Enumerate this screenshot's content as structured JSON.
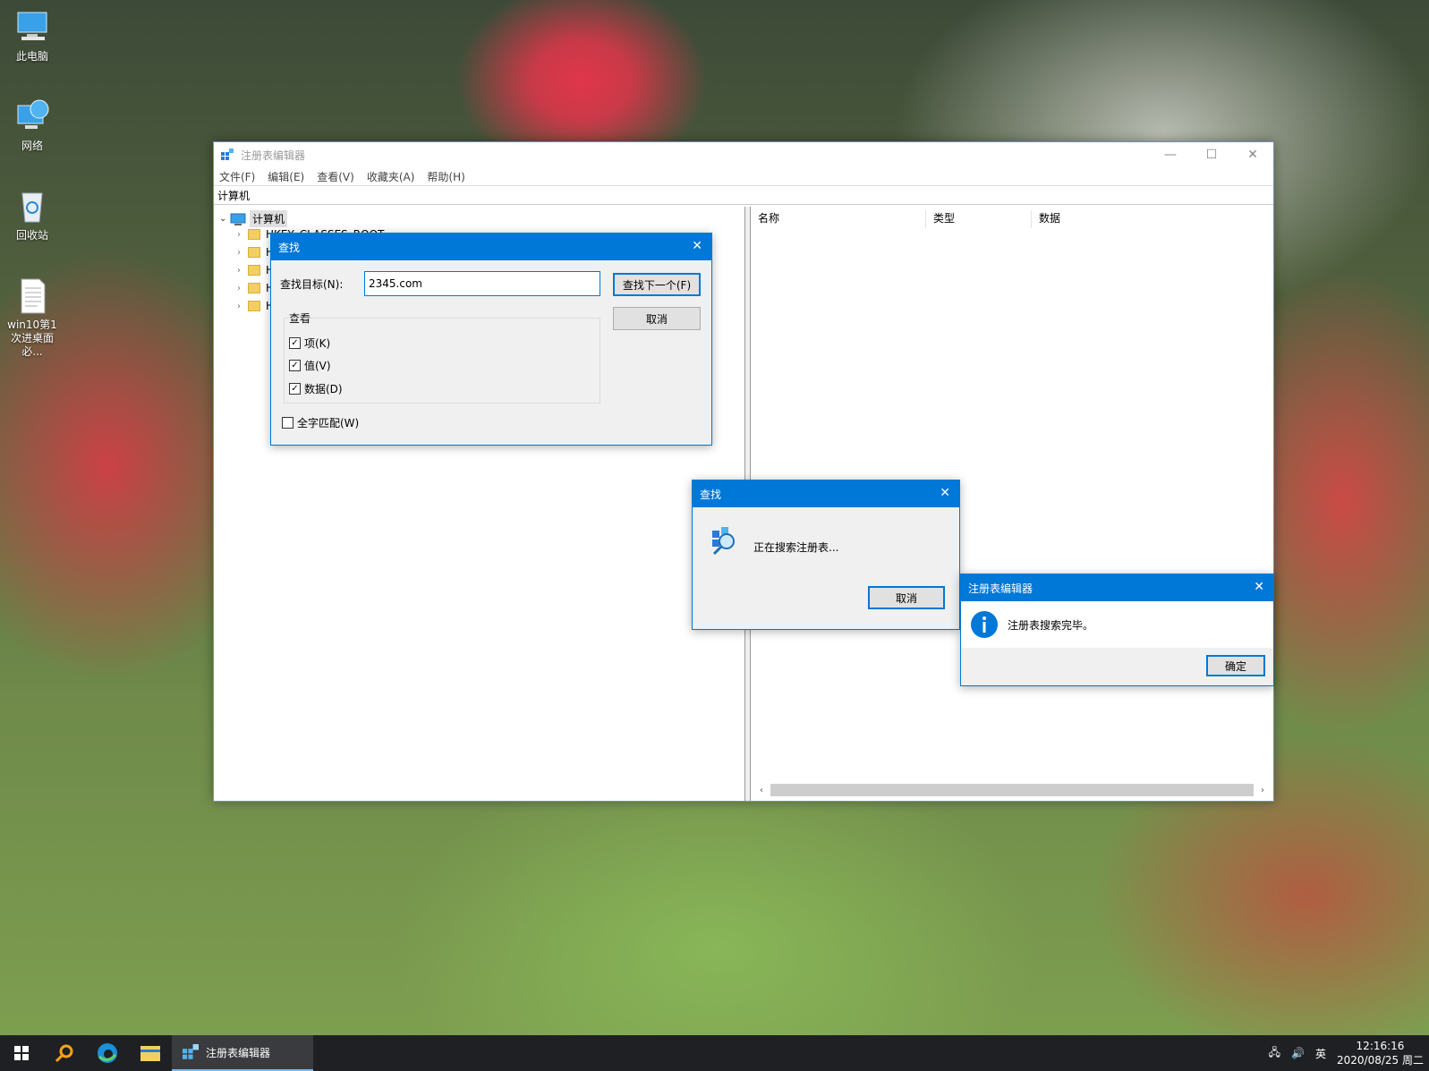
{
  "desktop": {
    "icons": [
      {
        "label": "此电脑"
      },
      {
        "label": "网络"
      },
      {
        "label": "回收站"
      },
      {
        "label": "win10第1次进桌面必..."
      }
    ]
  },
  "regedit": {
    "title": "注册表编辑器",
    "menu": [
      "文件(F)",
      "编辑(E)",
      "查看(V)",
      "收藏夹(A)",
      "帮助(H)"
    ],
    "address": "计算机",
    "tree_root": "计算机",
    "tree_rows": [
      "HKEY_CLASSES_ROOT",
      "H",
      "H",
      "H",
      "H"
    ],
    "columns": [
      "名称",
      "类型",
      "数据"
    ]
  },
  "find_dialog": {
    "title": "查找",
    "target_label": "查找目标(N):",
    "target_value": "2345.com",
    "find_next": "查找下一个(F)",
    "cancel": "取消",
    "look_group": "查看",
    "options": [
      {
        "label": "项(K)",
        "checked": true
      },
      {
        "label": "值(V)",
        "checked": true
      },
      {
        "label": "数据(D)",
        "checked": true
      }
    ],
    "whole_match": {
      "label": "全字匹配(W)",
      "checked": false
    }
  },
  "search_progress": {
    "title": "查找",
    "message": "正在搜索注册表...",
    "cancel": "取消"
  },
  "search_done": {
    "title": "注册表编辑器",
    "message": "注册表搜索完毕。",
    "ok": "确定"
  },
  "taskbar": {
    "active_app": "注册表编辑器",
    "ime": "英",
    "time": "12:16:16",
    "date": "2020/08/25 周二"
  },
  "colors": {
    "accent": "#0078d7",
    "taskbar": "#1f2023"
  }
}
